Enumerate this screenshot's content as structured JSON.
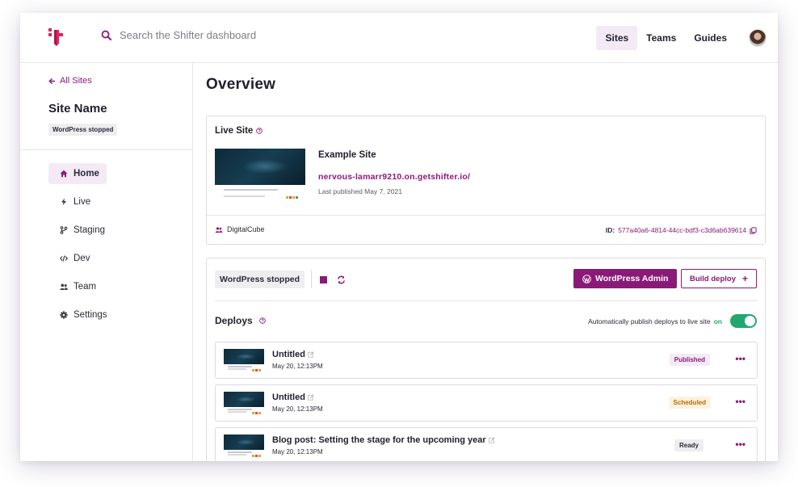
{
  "search": {
    "placeholder": "Search the Shifter dashboard"
  },
  "topnav": {
    "items": [
      {
        "label": "Sites"
      },
      {
        "label": "Teams"
      },
      {
        "label": "Guides"
      }
    ]
  },
  "sidebar": {
    "back_label": "All Sites",
    "site_name": "Site Name",
    "site_status": "WordPress stopped",
    "items": [
      {
        "label": "Home",
        "icon": "home-icon"
      },
      {
        "label": "Live",
        "icon": "bolt-icon"
      },
      {
        "label": "Staging",
        "icon": "branch-icon"
      },
      {
        "label": "Dev",
        "icon": "code-icon"
      },
      {
        "label": "Team",
        "icon": "users-icon"
      },
      {
        "label": "Settings",
        "icon": "gear-icon"
      }
    ]
  },
  "main": {
    "title": "Overview",
    "live_site": {
      "heading": "Live Site",
      "site_title": "Example Site",
      "url": "nervous-lamarr9210.on.getshifter.io/",
      "published": "Last published May 7, 2021",
      "team": "DigitalCube",
      "id_label": "ID:",
      "id_value": "577a40a6-4814-44cc-bdf3-c3d6ab639614"
    },
    "wordpress": {
      "status": "WordPress stopped",
      "admin_label": "WordPress Admin",
      "build_label": "Build deploy",
      "build_icon": "+"
    },
    "deploys": {
      "heading": "Deploys",
      "auto_publish_text": "Automatically publish deploys to live site",
      "auto_publish_state": "on",
      "items": [
        {
          "title": "Untitled",
          "date": "May 20, 12:13PM",
          "status": "Published"
        },
        {
          "title": "Untitled",
          "date": "May 20, 12:13PM",
          "status": "Scheduled"
        },
        {
          "title": "Blog post: Setting the stage for the upcoming year",
          "date": "May 20, 12:13PM",
          "status": "Ready"
        }
      ],
      "more_label": "•••"
    }
  },
  "colors": {
    "brand": "#8a1a78",
    "success": "#1fa971",
    "warning": "#b86a00",
    "text": "#1f1f2e"
  }
}
